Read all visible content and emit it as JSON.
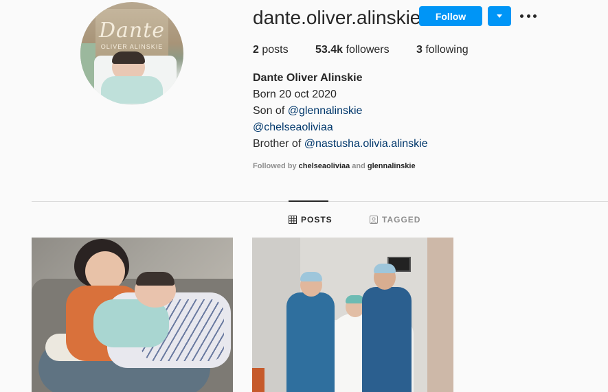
{
  "profile": {
    "username": "dante.oliver.alinskie",
    "follow_label": "Follow",
    "avatar_sign_script": "Dante",
    "avatar_sign_sub": "OLIVER ALINSKIE"
  },
  "stats": {
    "posts_count": "2",
    "posts_label": "posts",
    "followers_count": "53.4k",
    "followers_label": "followers",
    "following_count": "3",
    "following_label": "following"
  },
  "bio": {
    "full_name": "Dante Oliver Alinskie",
    "line1": "Born 20 oct 2020",
    "line2_prefix": "Son of ",
    "line2_mention": "@glennalinskie",
    "line3_mention": "@chelseaoliviaa",
    "line4_prefix": "Brother of ",
    "line4_mention": "@nastusha.olivia.alinskie"
  },
  "followed_by": {
    "prefix": "Followed by ",
    "user1": "chelseaoliviaa",
    "joiner": " and ",
    "user2": "glennalinskie"
  },
  "tabs": [
    {
      "label": "POSTS",
      "active": true,
      "icon": "grid-icon"
    },
    {
      "label": "TAGGED",
      "active": false,
      "icon": "tagged-icon"
    }
  ],
  "colors": {
    "follow_button": "#0095f6",
    "mention": "#00376b",
    "background": "#fafafa"
  }
}
